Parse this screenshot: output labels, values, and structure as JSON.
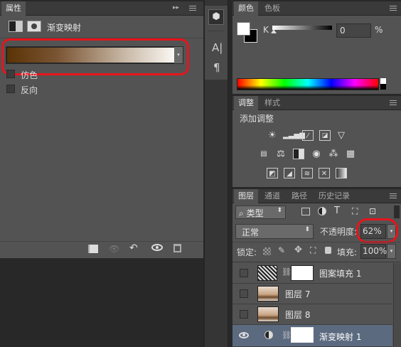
{
  "properties": {
    "tab": "属性",
    "title": "渐变映射",
    "dither": "仿色",
    "reverse": "反向"
  },
  "color": {
    "tabs": [
      "颜色",
      "色板"
    ],
    "channel": "K",
    "value": "0",
    "unit": "%"
  },
  "adjust": {
    "tabs": [
      "调整",
      "样式"
    ],
    "heading": "添加调整"
  },
  "layers": {
    "tabs": [
      "图层",
      "通道",
      "路径",
      "历史记录"
    ],
    "filter": "类型",
    "blend_mode": "正常",
    "opacity_label": "不透明度:",
    "opacity": "62%",
    "lock_label": "锁定:",
    "fill_label": "填充:",
    "fill": "100%",
    "rows": [
      {
        "name": "图案填充 1"
      },
      {
        "name": "图层 7"
      },
      {
        "name": "图层 8"
      },
      {
        "name": "渐变映射 1"
      }
    ]
  },
  "colors": {
    "highlight": "#e8141c",
    "selected_layer": "#5b6a7f"
  }
}
